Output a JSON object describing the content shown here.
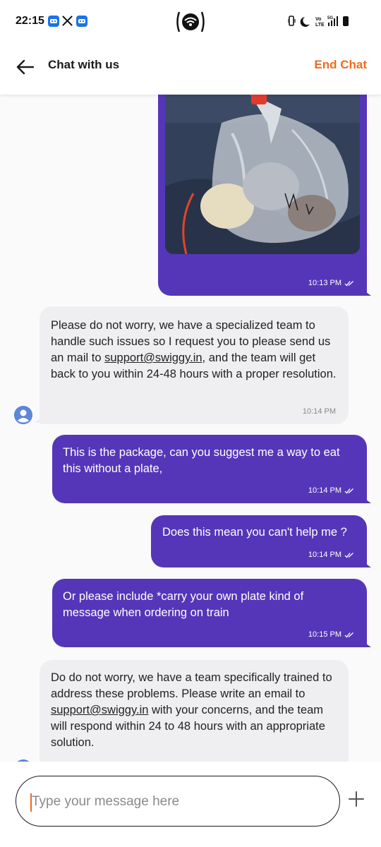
{
  "status_bar": {
    "time": "22:15",
    "network_label": "Vo LTE",
    "signal_label": "5G"
  },
  "header": {
    "title": "Chat with us",
    "end_chat_label": "End Chat"
  },
  "messages": [
    {
      "sender": "user",
      "kind": "image",
      "time": "10:13 PM",
      "read": true
    },
    {
      "sender": "agent",
      "text_before": "Please do not worry, we have a specialized team to handle such issues so I request you to please send us an mail to ",
      "link": "support@swiggy.in",
      "text_after": ", and the team will get back to you within 24-48 hours with a proper resolution.",
      "time": "10:14 PM"
    },
    {
      "sender": "user",
      "text": "This is the package, can you suggest me a way to eat this without a plate,",
      "time": "10:14 PM",
      "read": true
    },
    {
      "sender": "user",
      "text": "Does this mean you can't help me ?",
      "time": "10:14 PM",
      "read": true
    },
    {
      "sender": "user",
      "text": "Or please include *carry your own plate kind of message when ordering on train",
      "time": "10:15 PM",
      "read": true
    },
    {
      "sender": "agent",
      "text_before": "Do do not worry, we have a team specifically trained to address these problems. Please write an email to ",
      "link": "support@swiggy.in",
      "text_after": " with your concerns, and the team will respond within 24 to 48 hours with an appropriate solution."
    }
  ],
  "composer": {
    "placeholder": "Type your message here"
  },
  "colors": {
    "accent": "#f26a1b",
    "outgoing_bubble": "#5536b8",
    "incoming_bubble": "#efeff2"
  }
}
